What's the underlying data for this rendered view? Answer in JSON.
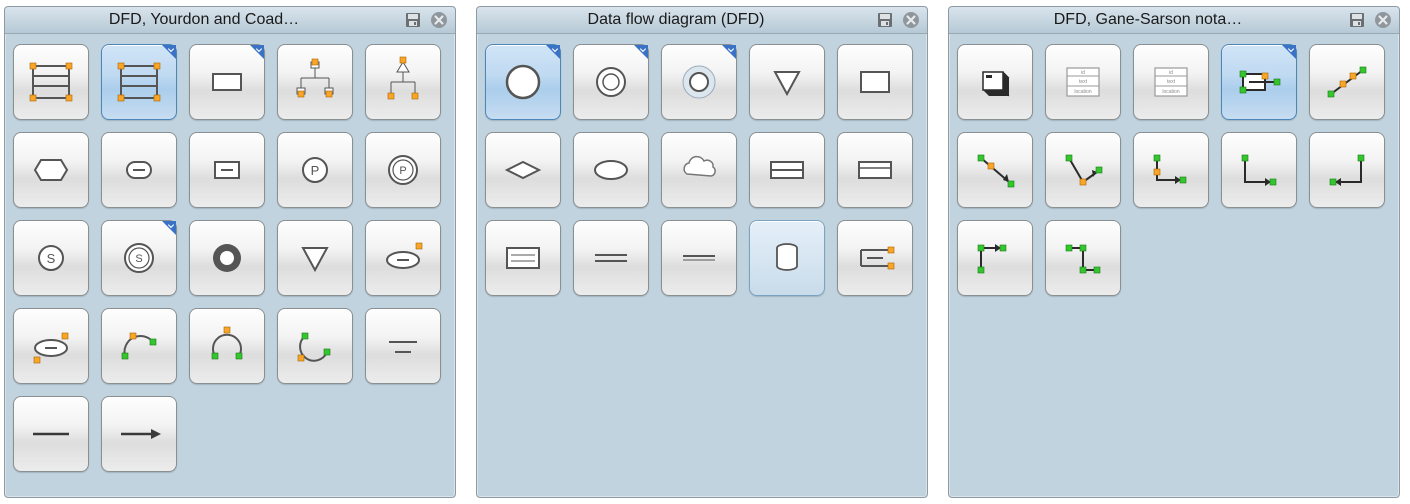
{
  "panels": [
    {
      "title": "DFD, Yourdon and Coad…",
      "shapes": [
        {
          "id": "data-store-1",
          "selected": false,
          "tick": false
        },
        {
          "id": "data-store-2",
          "selected": true,
          "tick": true
        },
        {
          "id": "rect-page",
          "selected": false,
          "tick": true
        },
        {
          "id": "hierarchy",
          "selected": false,
          "tick": false
        },
        {
          "id": "hierarchy-tri",
          "selected": false,
          "tick": false
        },
        {
          "id": "hexagon",
          "selected": false,
          "tick": false
        },
        {
          "id": "round-rect-dash",
          "selected": false,
          "tick": false
        },
        {
          "id": "rect-dash",
          "selected": false,
          "tick": false
        },
        {
          "id": "circle-p",
          "selected": false,
          "tick": false
        },
        {
          "id": "circle-p-ring",
          "selected": false,
          "tick": false
        },
        {
          "id": "circle-s",
          "selected": false,
          "tick": false
        },
        {
          "id": "circle-s-ring",
          "selected": false,
          "tick": true
        },
        {
          "id": "donut-thick",
          "selected": false,
          "tick": false
        },
        {
          "id": "triangle-down",
          "selected": false,
          "tick": false
        },
        {
          "id": "ellipse-dash-handle",
          "selected": false,
          "tick": false
        },
        {
          "id": "ellipse-dash-handle2",
          "selected": false,
          "tick": false
        },
        {
          "id": "arc-handles",
          "selected": false,
          "tick": false
        },
        {
          "id": "arc-handles-2",
          "selected": false,
          "tick": false
        },
        {
          "id": "arc-handles-3",
          "selected": false,
          "tick": false
        },
        {
          "id": "two-lines",
          "selected": false,
          "tick": false
        },
        {
          "id": "line-plain",
          "selected": false,
          "tick": false
        },
        {
          "id": "line-arrow",
          "selected": false,
          "tick": false
        }
      ]
    },
    {
      "title": "Data flow diagram (DFD)",
      "shapes": [
        {
          "id": "big-circle",
          "selected": true,
          "tick": true
        },
        {
          "id": "donut-thin",
          "selected": false,
          "tick": true
        },
        {
          "id": "donut-glow",
          "selected": false,
          "tick": true
        },
        {
          "id": "triangle-down",
          "selected": false,
          "tick": false
        },
        {
          "id": "rect-plain",
          "selected": false,
          "tick": false
        },
        {
          "id": "diamond",
          "selected": false,
          "tick": false
        },
        {
          "id": "ellipse-solid",
          "selected": false,
          "tick": false
        },
        {
          "id": "cloud",
          "selected": false,
          "tick": false
        },
        {
          "id": "rect-split-h",
          "selected": false,
          "tick": false
        },
        {
          "id": "rect-split-h2",
          "selected": false,
          "tick": false
        },
        {
          "id": "triple-lines",
          "selected": false,
          "tick": false
        },
        {
          "id": "double-lines",
          "selected": false,
          "tick": false
        },
        {
          "id": "single-line",
          "selected": false,
          "tick": false
        },
        {
          "id": "cylinder",
          "selected": false,
          "tick": false,
          "selectedLight": true
        },
        {
          "id": "open-rect",
          "selected": false,
          "tick": false
        }
      ]
    },
    {
      "title": "DFD, Gane-Sarson nota…",
      "shapes": [
        {
          "id": "cube-dark",
          "selected": false,
          "tick": false
        },
        {
          "id": "table-small",
          "selected": false,
          "tick": false
        },
        {
          "id": "table-small-2",
          "selected": false,
          "tick": false
        },
        {
          "id": "rect-line-handles",
          "selected": true,
          "tick": true
        },
        {
          "id": "diag-line-handles",
          "selected": false,
          "tick": false
        },
        {
          "id": "connector-1",
          "selected": false,
          "tick": false
        },
        {
          "id": "connector-2",
          "selected": false,
          "tick": false
        },
        {
          "id": "connector-3",
          "selected": false,
          "tick": false
        },
        {
          "id": "connector-4",
          "selected": false,
          "tick": false
        },
        {
          "id": "connector-5",
          "selected": false,
          "tick": false
        },
        {
          "id": "connector-6",
          "selected": false,
          "tick": false
        },
        {
          "id": "connector-7",
          "selected": false,
          "tick": false
        }
      ]
    }
  ]
}
